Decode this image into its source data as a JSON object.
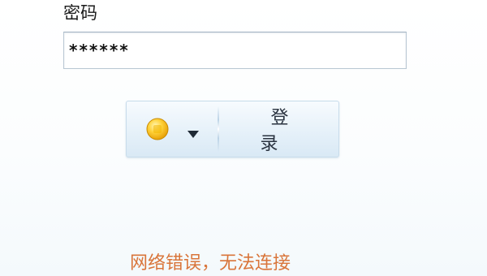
{
  "login": {
    "password_label": "密码",
    "password_value": "******",
    "login_button_label": "登 录",
    "status_icon": "online-status-orb-icon",
    "dropdown_icon": "caret-down-icon",
    "error_message": "网络错误，无法连接"
  },
  "colors": {
    "error_text": "#d9753a",
    "field_border": "#b9c7d3",
    "button_bar": "#e6f1f9",
    "status_orb": "#f0b400"
  }
}
